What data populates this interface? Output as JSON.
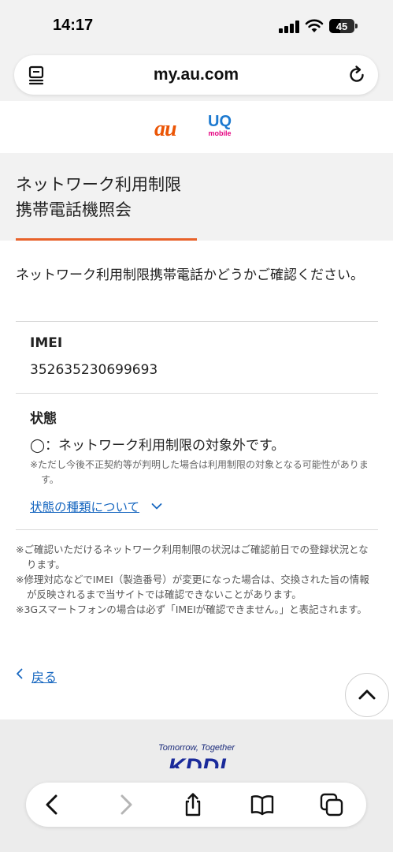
{
  "status_bar": {
    "time": "14:17",
    "battery": "45",
    "battery_level": 0.45
  },
  "browser": {
    "url": "my.au.com"
  },
  "brand": {
    "au": "au",
    "uq": "UQ",
    "uq_sub": "mobile",
    "accent_orange": "#eb5505",
    "uq_blue": "#1d7ad0",
    "uq_pink": "#e4007f"
  },
  "page": {
    "title_line1": "ネットワーク利用制限",
    "title_line2": "携帯電話機照会",
    "intro": "ネットワーク利用制限携帯電話かどうかご確認ください。",
    "imei_label": "IMEI",
    "imei_value": "352635230699693",
    "status_label": "状態",
    "status_value": "◯：ネットワーク利用制限の対象外です。",
    "status_note": "※ただし今後不正契約等が判明した場合は利用制限の対象となる可能性があります。",
    "status_types_link": "状態の種類について",
    "notes": [
      "※ご確認いただけるネットワーク利用制限の状況はご確認前日での登録状況となります。",
      "※修理対応などでIMEI（製造番号）が変更になった場合は、交換された旨の情報が反映されるまで当サイトでは確認できないことがあります。",
      "※3Gスマートフォンの場合は必ず「IMEIが確認できません。」と表記されます。"
    ],
    "back_link": "戻る",
    "accent_color": "#e8622a",
    "link_color": "#1767c0"
  },
  "footer": {
    "tagline": "Tomorrow, Together",
    "logo": "KDDI"
  }
}
